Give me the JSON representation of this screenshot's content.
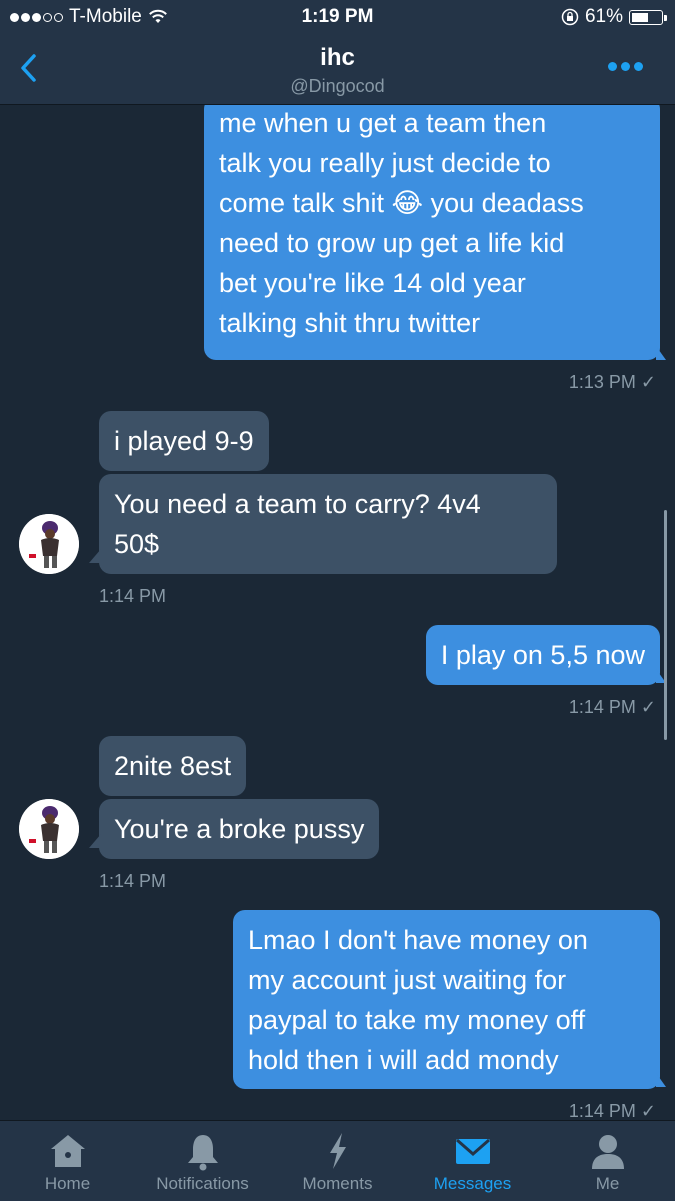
{
  "status_bar": {
    "carrier": "T-Mobile",
    "time": "1:19 PM",
    "battery": "61%",
    "battery_level": 0.61,
    "signal_bars_full": 3,
    "signal_bars_total": 5
  },
  "header": {
    "name": "ihc",
    "handle": "@Dingocod",
    "back_icon": "chevron-left-icon",
    "more_icon": "more-dots-icon"
  },
  "colors": {
    "accent": "#1da1f2",
    "outgoing_bubble": "#3d8fe0",
    "incoming_bubble": "#3d5166",
    "background": "#1b2836",
    "bar_background": "#243447"
  },
  "messages": [
    {
      "dir": "out",
      "text": "me when u get a team then\ntalk you really just decide to\ncome talk shit 😂 you deadass\nneed to grow up get a life kid\nbet you're like 14 old year\ntalking shit thru twitter",
      "time": "1:13 PM ✓"
    },
    {
      "dir": "in",
      "text": "i played 9-9"
    },
    {
      "dir": "in",
      "text": "You need a team to carry? 4v4\n50$",
      "time": "1:14 PM"
    },
    {
      "dir": "out",
      "text": "I play on 5,5 now",
      "time": "1:14 PM ✓"
    },
    {
      "dir": "in",
      "text": "2nite 8est"
    },
    {
      "dir": "in",
      "text": "You're a broke pussy",
      "time": "1:14 PM"
    },
    {
      "dir": "out",
      "text": "Lmao I don't have money on\nmy account just waiting for\npaypal to take my money off\nhold then i will add mondy",
      "time": "1:14 PM ✓"
    }
  ],
  "tabs": [
    {
      "label": "Home",
      "icon": "home-icon",
      "active": false
    },
    {
      "label": "Notifications",
      "icon": "bell-icon",
      "active": false
    },
    {
      "label": "Moments",
      "icon": "lightning-icon",
      "active": false
    },
    {
      "label": "Messages",
      "icon": "envelope-icon",
      "active": true
    },
    {
      "label": "Me",
      "icon": "person-icon",
      "active": false
    }
  ]
}
